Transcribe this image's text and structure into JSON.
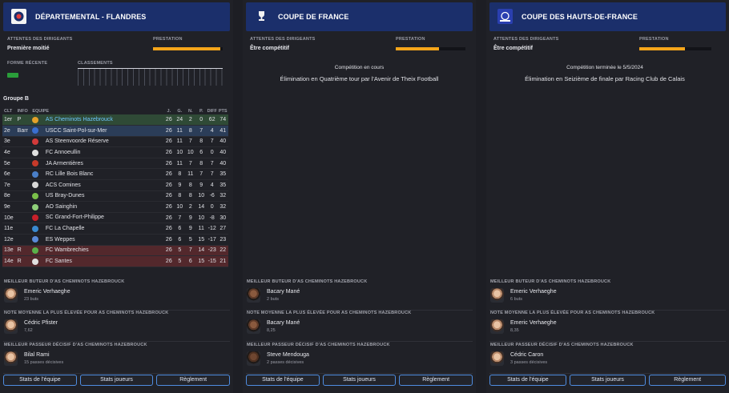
{
  "panels": [
    {
      "title": "DÉPARTEMENTAL - FLANDRES",
      "attentes_label": "ATTENTES DES DIRIGEANTS",
      "attentes_value": "Première moitié",
      "prestation_label": "PRESTATION",
      "prestation_level": 0.96,
      "forme_label": "FORME RÉCENTE",
      "classements_label": "CLASSEMENTS",
      "group": "Groupe B",
      "headers": [
        "CLT",
        "INFO",
        "EQUIPE",
        "J.",
        "G.",
        "N.",
        "P.",
        "DIFF",
        "PTS"
      ],
      "rows": [
        {
          "clt": "1er",
          "info": "P",
          "team": "AS Cheminots Hazebrouck",
          "j": "26",
          "g": "24",
          "n": "2",
          "p": "0",
          "diff": "62",
          "pts": "74",
          "zone": "green",
          "crest": "#e3a12a"
        },
        {
          "clt": "2e",
          "info": "Barr",
          "team": "USCC Saint-Pol-sur-Mer",
          "j": "26",
          "g": "11",
          "n": "8",
          "p": "7",
          "diff": "4",
          "pts": "41",
          "zone": "blue",
          "crest": "#3a6fd0"
        },
        {
          "clt": "3e",
          "info": "",
          "team": "AS Steenvoorde Réserve",
          "j": "26",
          "g": "11",
          "n": "7",
          "p": "8",
          "diff": "7",
          "pts": "40",
          "zone": "",
          "crest": "#d23a3a"
        },
        {
          "clt": "4e",
          "info": "",
          "team": "FC Annoeullin",
          "j": "26",
          "g": "10",
          "n": "10",
          "p": "6",
          "diff": "0",
          "pts": "40",
          "zone": "",
          "crest": "#e0e0e0"
        },
        {
          "clt": "5e",
          "info": "",
          "team": "JA Armentières",
          "j": "26",
          "g": "11",
          "n": "7",
          "p": "8",
          "diff": "7",
          "pts": "40",
          "zone": "",
          "crest": "#c63a2a"
        },
        {
          "clt": "6e",
          "info": "",
          "team": "RC Lille Bois Blanc",
          "j": "26",
          "g": "8",
          "n": "11",
          "p": "7",
          "diff": "7",
          "pts": "35",
          "zone": "",
          "crest": "#4a7fc8"
        },
        {
          "clt": "7e",
          "info": "",
          "team": "ACS Comines",
          "j": "26",
          "g": "9",
          "n": "8",
          "p": "9",
          "diff": "4",
          "pts": "35",
          "zone": "",
          "crest": "#d8d8d8"
        },
        {
          "clt": "8e",
          "info": "",
          "team": "US Bray-Dunes",
          "j": "26",
          "g": "8",
          "n": "8",
          "p": "10",
          "diff": "-6",
          "pts": "32",
          "zone": "",
          "crest": "#7ac04a"
        },
        {
          "clt": "9e",
          "info": "",
          "team": "AO Sainghin",
          "j": "26",
          "g": "10",
          "n": "2",
          "p": "14",
          "diff": "0",
          "pts": "32",
          "zone": "",
          "crest": "#8fcf7a"
        },
        {
          "clt": "10e",
          "info": "",
          "team": "SC Grand-Fort-Philippe",
          "j": "26",
          "g": "7",
          "n": "9",
          "p": "10",
          "diff": "-8",
          "pts": "30",
          "zone": "",
          "crest": "#c8202a"
        },
        {
          "clt": "11e",
          "info": "",
          "team": "FC La Chapelle",
          "j": "26",
          "g": "6",
          "n": "9",
          "p": "11",
          "diff": "-12",
          "pts": "27",
          "zone": "",
          "crest": "#3a8ad0"
        },
        {
          "clt": "12e",
          "info": "",
          "team": "ES Weppes",
          "j": "26",
          "g": "6",
          "n": "5",
          "p": "15",
          "diff": "-17",
          "pts": "23",
          "zone": "",
          "crest": "#5a8ad8"
        },
        {
          "clt": "13e",
          "info": "R",
          "team": "FC Wambrechies",
          "j": "26",
          "g": "5",
          "n": "7",
          "p": "14",
          "diff": "-23",
          "pts": "22",
          "zone": "red",
          "crest": "#5ab04a"
        },
        {
          "clt": "14e",
          "info": "R",
          "team": "FC Santes",
          "j": "26",
          "g": "5",
          "n": "6",
          "p": "15",
          "diff": "-15",
          "pts": "21",
          "zone": "red",
          "crest": "#e0e0e0"
        }
      ],
      "buteur_title": "MEILLEUR BUTEUR D'AS CHEMINOTS HAZEBROUCK",
      "buteur_name": "Emeric Verhaeghe",
      "buteur_stat": "23 buts",
      "note_title": "NOTE MOYENNE LA PLUS ÉLEVÉE POUR AS CHEMINOTS HAZEBROUCK",
      "note_name": "Cédric Pfister",
      "note_stat": "7,62",
      "passeur_title": "MEILLEUR PASSEUR DÉCISIF D'AS CHEMINOTS HAZEBROUCK",
      "passeur_name": "Bilal Rami",
      "passeur_stat": "15 passes décisives",
      "btn_team": "Stats de l'équipe",
      "btn_players": "Stats joueurs",
      "btn_rules": "Règlement"
    },
    {
      "title": "COUPE DE FRANCE",
      "attentes_label": "ATTENTES DES DIRIGEANTS",
      "attentes_value": "Être compétitif",
      "prestation_label": "PRESTATION",
      "prestation_level": 0.62,
      "status": "Compétition en cours",
      "result": "Élimination en Quatrième tour par l'Avenir de Theix Football",
      "buteur_title": "MEILLEUR BUTEUR D'AS CHEMINOTS HAZEBROUCK",
      "buteur_name": "Bacary Mané",
      "buteur_stat": "2 buts",
      "note_title": "NOTE MOYENNE LA PLUS ÉLEVÉE POUR AS CHEMINOTS HAZEBROUCK",
      "note_name": "Bacary Mané",
      "note_stat": "8,25",
      "passeur_title": "MEILLEUR PASSEUR DÉCISIF D'AS CHEMINOTS HAZEBROUCK",
      "passeur_name": "Steve Mendouga",
      "passeur_stat": "2 passes décisives",
      "btn_team": "Stats de l'équipe",
      "btn_players": "Stats joueurs",
      "btn_rules": "Règlement"
    },
    {
      "title": "COUPE DES HAUTS-DE-FRANCE",
      "attentes_label": "ATTENTES DES DIRIGEANTS",
      "attentes_value": "Être compétitif",
      "prestation_label": "PRESTATION",
      "prestation_level": 0.63,
      "status": "Compétition terminée le 5/5/2024",
      "result": "Élimination en Seizième de finale par Racing Club de Calais",
      "buteur_title": "MEILLEUR BUTEUR D'AS CHEMINOTS HAZEBROUCK",
      "buteur_name": "Emeric Verhaeghe",
      "buteur_stat": "6 buts",
      "note_title": "NOTE MOYENNE LA PLUS ÉLEVÉE POUR AS CHEMINOTS HAZEBROUCK",
      "note_name": "Emeric Verhaeghe",
      "note_stat": "8,35",
      "passeur_title": "MEILLEUR PASSEUR DÉCISIF D'AS CHEMINOTS HAZEBROUCK",
      "passeur_name": "Cédric Caron",
      "passeur_stat": "3 passes décisives",
      "btn_team": "Stats de l'équipe",
      "btn_players": "Stats joueurs",
      "btn_rules": "Règlement"
    }
  ],
  "colors": {
    "accent": "#f5a51a",
    "header": "#1b2f6b",
    "promotion": "#2f4a36",
    "playoff": "#2b3d58",
    "relegation": "#53282c"
  }
}
